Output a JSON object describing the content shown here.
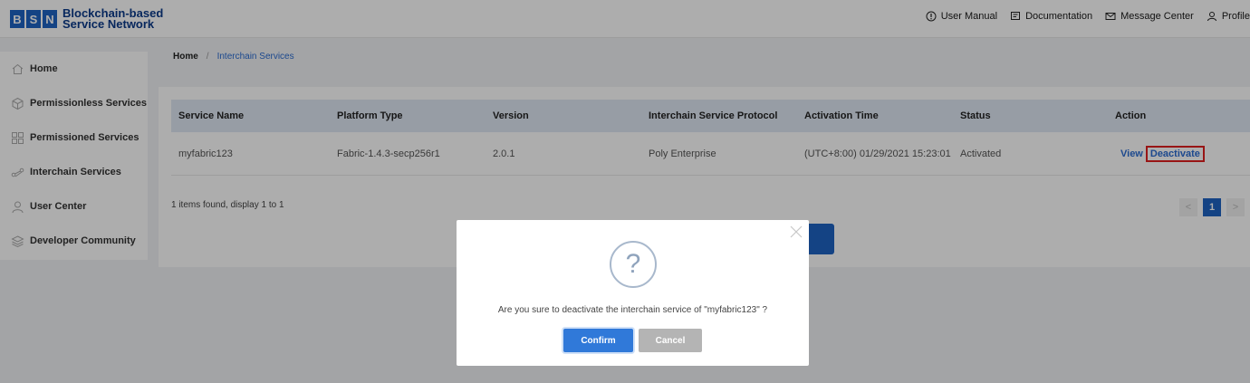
{
  "logo": {
    "letters": [
      "B",
      "S",
      "N"
    ],
    "line1": "Blockchain-based",
    "line2": "Service Network"
  },
  "header": {
    "links": [
      {
        "label": "User Manual",
        "icon": "info-circle-icon"
      },
      {
        "label": "Documentation",
        "icon": "document-icon"
      },
      {
        "label": "Message Center",
        "icon": "mail-icon"
      },
      {
        "label": "Profile",
        "icon": "user-icon"
      }
    ]
  },
  "sidebar": {
    "items": [
      {
        "label": "Home",
        "icon": "home-icon"
      },
      {
        "label": "Permissionless Services",
        "icon": "cube-icon"
      },
      {
        "label": "Permissioned Services",
        "icon": "grid-icon"
      },
      {
        "label": "Interchain Services",
        "icon": "interchain-icon"
      },
      {
        "label": "User Center",
        "icon": "user-icon"
      },
      {
        "label": "Developer Community",
        "icon": "layers-icon"
      }
    ]
  },
  "breadcrumb": {
    "home": "Home",
    "separator": "/",
    "current": "Interchain Services"
  },
  "table": {
    "headers": [
      "Service Name",
      "Platform Type",
      "Version",
      "Interchain Service Protocol",
      "Activation Time",
      "Status",
      "Action"
    ],
    "rows": [
      {
        "service_name": "myfabric123",
        "platform_type": "Fabric-1.4.3-secp256r1",
        "version": "2.0.1",
        "protocol": "Poly Enterprise",
        "activation_time": "(UTC+8:00) 01/29/2021 15:23:01",
        "status": "Activated",
        "action_view": "View",
        "action_deactivate": "Deactivate"
      }
    ]
  },
  "summary": "1 items found, display 1 to 1",
  "pagination": {
    "prev": "<",
    "current": "1",
    "next": ">"
  },
  "modal": {
    "icon": "?",
    "message": "Are you sure to deactivate the interchain service of \"myfabric123\" ?",
    "confirm": "Confirm",
    "cancel": "Cancel"
  },
  "colors": {
    "primary": "#1e64c3",
    "link": "#2b6cd1",
    "highlight": "#e02020",
    "cancel": "#b4b4b4"
  }
}
